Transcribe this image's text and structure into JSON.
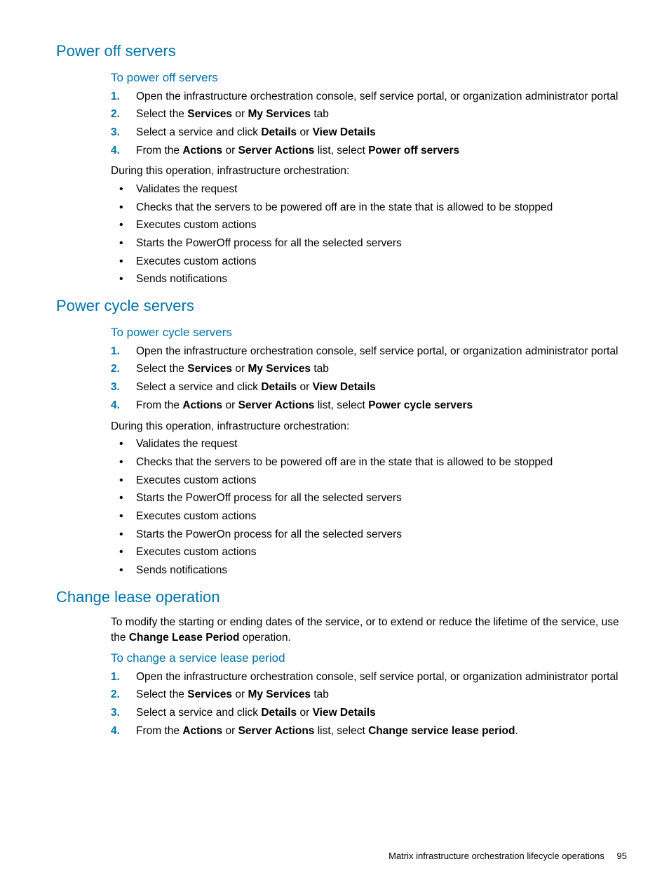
{
  "section1": {
    "heading": "Power off servers",
    "subheading": "To power off servers",
    "steps": [
      {
        "pre": "Open the infrastructure orchestration console, self service portal, or organization administrator portal"
      },
      {
        "pre": "Select the ",
        "b1": "Services",
        "mid1": " or ",
        "b2": "My Services",
        "post": " tab"
      },
      {
        "pre": "Select a service and click ",
        "b1": "Details",
        "mid1": " or ",
        "b2": "View Details"
      },
      {
        "pre": "From the ",
        "b1": "Actions",
        "mid1": " or ",
        "b2": "Server Actions",
        "mid2": " list, select ",
        "b3": "Power off servers"
      }
    ],
    "lead": "During this operation, infrastructure orchestration:",
    "bullets": [
      "Validates the request",
      "Checks that the servers to be powered off are in the state that is allowed to be stopped",
      "Executes custom actions",
      "Starts the PowerOff process for all the selected servers",
      "Executes custom actions",
      "Sends notifications"
    ]
  },
  "section2": {
    "heading": "Power cycle servers",
    "subheading": "To power cycle servers",
    "steps": [
      {
        "pre": "Open the infrastructure orchestration console, self service portal, or organization administrator portal"
      },
      {
        "pre": "Select the ",
        "b1": "Services",
        "mid1": " or ",
        "b2": "My Services",
        "post": " tab"
      },
      {
        "pre": "Select a service and click ",
        "b1": "Details",
        "mid1": " or ",
        "b2": "View Details"
      },
      {
        "pre": "From the ",
        "b1": "Actions",
        "mid1": " or ",
        "b2": "Server Actions",
        "mid2": " list, select ",
        "b3": "Power cycle servers"
      }
    ],
    "lead": "During this operation, infrastructure orchestration:",
    "bullets": [
      "Validates the request",
      "Checks that the servers to be powered off are in the state that is allowed to be stopped",
      "Executes custom actions",
      "Starts the PowerOff process for all the selected servers",
      "Executes custom actions",
      "Starts the PowerOn process for all the selected servers",
      "Executes custom actions",
      "Sends notifications"
    ]
  },
  "section3": {
    "heading": "Change lease operation",
    "intro_pre": "To modify the starting or ending dates of the service, or to extend or reduce the lifetime of the service, use the ",
    "intro_bold": "Change Lease Period",
    "intro_post": " operation.",
    "subheading": "To change a service lease period",
    "steps": [
      {
        "pre": "Open the infrastructure orchestration console, self service portal, or organization administrator portal"
      },
      {
        "pre": "Select the ",
        "b1": "Services",
        "mid1": " or ",
        "b2": "My Services",
        "post": " tab"
      },
      {
        "pre": "Select a service and click ",
        "b1": "Details",
        "mid1": " or ",
        "b2": "View Details"
      },
      {
        "pre": "From the ",
        "b1": "Actions",
        "mid1": " or ",
        "b2": "Server Actions",
        "mid2": " list, select ",
        "b3": "Change service lease period",
        "post": "."
      }
    ]
  },
  "footer": {
    "text": "Matrix infrastructure orchestration lifecycle operations",
    "page": "95"
  }
}
